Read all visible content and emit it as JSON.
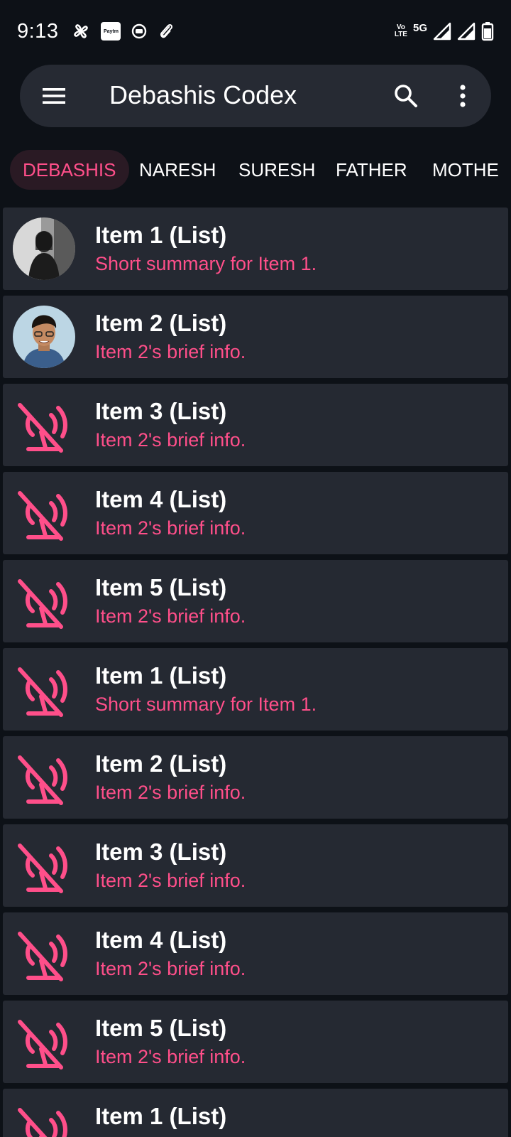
{
  "status_bar": {
    "time": "9:13",
    "left_icons": [
      "pinwheel-icon",
      "paytm-icon",
      "media-icon",
      "attachment-icon"
    ],
    "paytm_label": "Paytm",
    "volte_label_top": "Vo",
    "volte_label_bottom": "LTE",
    "network_label": "5G",
    "right_icons": [
      "volte-icon",
      "signal-icon",
      "signal-icon",
      "battery-icon"
    ]
  },
  "app_bar": {
    "title": "Debashis Codex",
    "icons": [
      "menu-icon",
      "search-icon",
      "more-vert-icon"
    ]
  },
  "tabs": [
    {
      "label": "DEBASHIS",
      "active": true
    },
    {
      "label": "NARESH",
      "active": false
    },
    {
      "label": "SURESH",
      "active": false
    },
    {
      "label": "FATHER",
      "active": false
    },
    {
      "label": "MOTHE",
      "active": false
    }
  ],
  "list": {
    "items": [
      {
        "title": "Item 1 (List)",
        "subtitle": "Short summary for Item 1.",
        "leading": "avatar-photo-1"
      },
      {
        "title": "Item 2 (List)",
        "subtitle": "Item 2's brief info.",
        "leading": "avatar-photo-2"
      },
      {
        "title": "Item 3 (List)",
        "subtitle": "Item 2's brief info.",
        "leading": "broken-image-icon"
      },
      {
        "title": "Item 4 (List)",
        "subtitle": "Item 2's brief info.",
        "leading": "broken-image-icon"
      },
      {
        "title": "Item 5 (List)",
        "subtitle": "Item 2's brief info.",
        "leading": "broken-image-icon"
      },
      {
        "title": "Item 1 (List)",
        "subtitle": "Short summary for Item 1.",
        "leading": "broken-image-icon"
      },
      {
        "title": "Item 2 (List)",
        "subtitle": "Item 2's brief info.",
        "leading": "broken-image-icon"
      },
      {
        "title": "Item 3 (List)",
        "subtitle": "Item 2's brief info.",
        "leading": "broken-image-icon"
      },
      {
        "title": "Item 4 (List)",
        "subtitle": "Item 2's brief info.",
        "leading": "broken-image-icon"
      },
      {
        "title": "Item 5 (List)",
        "subtitle": "Item 2's brief info.",
        "leading": "broken-image-icon"
      },
      {
        "title": "Item 1 (List)",
        "subtitle": "",
        "leading": "broken-image-icon"
      }
    ]
  },
  "colors": {
    "background": "#0d1117",
    "surface": "#252932",
    "app_bar": "#262a33",
    "accent": "#ff4f8a",
    "active_tab_bg": "#2a1a24",
    "text": "#ffffff"
  }
}
